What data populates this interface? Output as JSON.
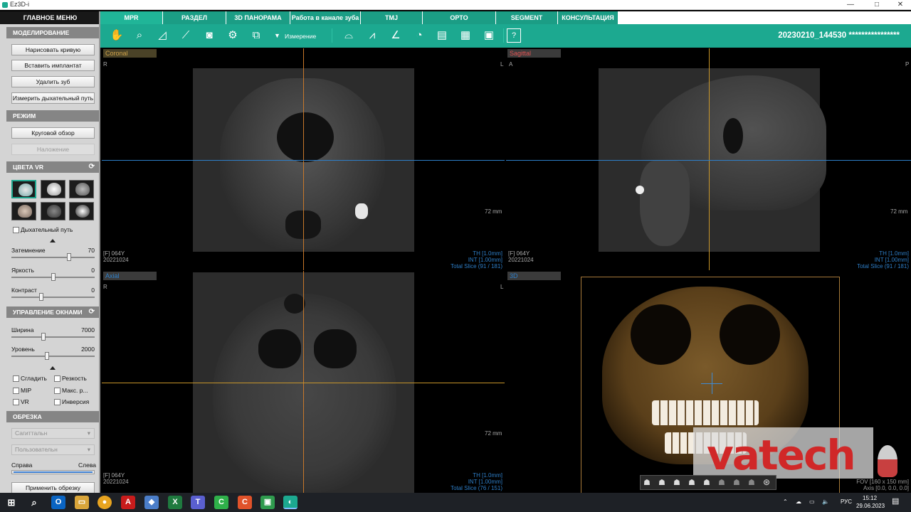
{
  "window": {
    "title": "Ez3D-i",
    "controls": [
      "—",
      "□",
      "✕"
    ]
  },
  "left_panel": {
    "main_menu": "ГЛАВНОЕ МЕНЮ",
    "modeling": {
      "title": "МОДЕЛИРОВАНИЕ",
      "buttons": [
        "Нарисовать кривую",
        "Вставить имплантат",
        "Удалить зуб",
        "Измерить дыхательный путь"
      ]
    },
    "mode": {
      "title": "РЕЖИМ",
      "buttons": [
        "Круговой обзор",
        "Наложение"
      ]
    },
    "vr_colors": {
      "title": "ЦВЕТА VR",
      "airway": "Дыхательный путь",
      "sliders": [
        {
          "label": "Затемнение",
          "value": "70",
          "fraction": 0.7
        },
        {
          "label": "Яркость",
          "value": "0",
          "fraction": 0.5
        },
        {
          "label": "Контраст",
          "value": "0",
          "fraction": 0.35
        }
      ]
    },
    "window_ctrl": {
      "title": "УПРАВЛЕНИЕ ОКНАМИ",
      "sliders": [
        {
          "label": "Ширина",
          "value": "7000",
          "fraction": 0.38
        },
        {
          "label": "Уровень",
          "value": "2000",
          "fraction": 0.42
        }
      ],
      "checks": [
        "Сгладить",
        "Резкость",
        "MIP",
        "Макс. р...",
        "VR",
        "Инверсия"
      ]
    },
    "crop": {
      "title": "ОБРЕЗКА",
      "dropdowns": [
        "Сагиттальн",
        "Пользовательн"
      ],
      "left": "Справа",
      "right": "Слева",
      "apply": "Применить обрезку"
    }
  },
  "tabs": [
    "MPR",
    "РАЗДЕЛ",
    "3D ПАНОРАМА",
    "Работа в канале зуба",
    "TMJ",
    "ОРТО",
    "SEGMENT",
    "КОНСУЛЬТАЦИЯ"
  ],
  "toolbar": {
    "measure": "Измерение",
    "patient": "20230210_144530 ****************",
    "help": "?"
  },
  "viewports": {
    "coronal": {
      "tag": "Coronal",
      "left": "R",
      "right": "L",
      "scale": "72 mm",
      "info1": "[F] 064Y",
      "info2": "20221024",
      "th": "TH [1.0mm]",
      "int": "INT [1.00mm]",
      "slice": "Total Slice (91 / 181)"
    },
    "sagittal": {
      "tag": "Sagittal",
      "left": "A",
      "right": "P",
      "scale": "72 mm",
      "info1": "[F] 064Y",
      "info2": "20221024",
      "th": "TH [1.0mm]",
      "int": "INT [1.00mm]",
      "slice": "Total Slice (91 / 181)"
    },
    "axial": {
      "tag": "Axial",
      "left": "R",
      "right": "L",
      "scale": "72 mm",
      "info1": "[F] 064Y",
      "info2": "20221024",
      "th": "TH [1.0mm]",
      "int": "INT [1.00mm]",
      "slice": "Total Slice (76 / 151)"
    },
    "v3d": {
      "tag": "3D",
      "fov": "FOV [160 x 150 mm]",
      "axis": "Axis [0.0, 0.0, 0.0]",
      "watermark": "vatech"
    }
  },
  "taskbar": {
    "lang": "РУС",
    "time": "15:12",
    "date": "29.06.2023"
  },
  "colors": {
    "accent": "#1ca990",
    "tab": "#1b9d85",
    "coronal_line": "#c8782a",
    "axial_line": "#2e7fc9"
  }
}
